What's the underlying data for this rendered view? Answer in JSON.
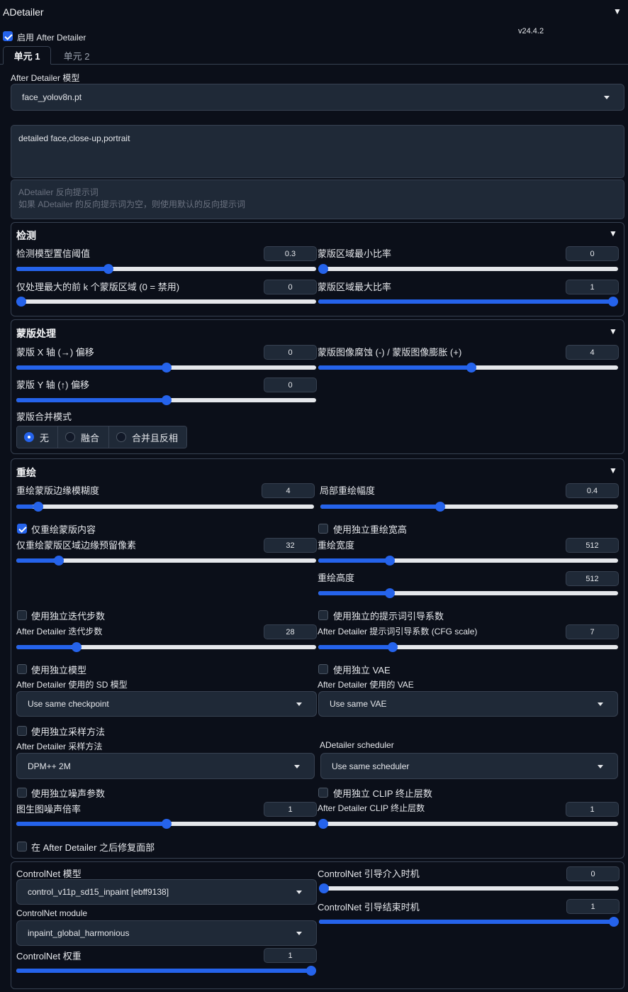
{
  "panel": {
    "title": "ADetailer",
    "version": "v24.4.2",
    "enable_label": "启用 After Detailer",
    "enabled": true
  },
  "tabs": [
    {
      "label": "单元 1",
      "active": true
    },
    {
      "label": "单元 2",
      "active": false
    }
  ],
  "model": {
    "label": "After Detailer 模型",
    "value": "face_yolov8n.pt"
  },
  "prompt": {
    "value": "detailed face,close-up,portrait"
  },
  "negative_prompt": {
    "placeholder_line1": "ADetailer 反向提示词",
    "placeholder_line2": "如果 ADetailer 的反向提示词为空，则使用默认的反向提示词"
  },
  "detection": {
    "title": "检测",
    "confidence": {
      "label": "检测模型置信阈值",
      "value": "0.3",
      "fraction": 0.3
    },
    "mask_min": {
      "label": "蒙版区域最小比率",
      "value": "0",
      "fraction": 0.0
    },
    "top_k": {
      "label": "仅处理最大的前 k 个蒙版区域 (0 = 禁用)",
      "value": "0",
      "fraction": 0.0
    },
    "mask_max": {
      "label": "蒙版区域最大比率",
      "value": "1",
      "fraction": 1.0
    }
  },
  "mask_processing": {
    "title": "蒙版处理",
    "x_offset": {
      "label": "蒙版 X 轴 (→) 偏移",
      "value": "0",
      "fraction": 0.5
    },
    "erode_dilate": {
      "label": "蒙版图像腐蚀 (-) / 蒙版图像膨胀 (+)",
      "value": "4",
      "fraction": 0.51
    },
    "y_offset": {
      "label": "蒙版 Y 轴 (↑) 偏移",
      "value": "0",
      "fraction": 0.5
    },
    "merge_mode": {
      "label": "蒙版合并模式",
      "options": [
        "无",
        "融合",
        "合并且反相"
      ],
      "selected": "无"
    }
  },
  "inpaint": {
    "title": "重绘",
    "mask_blur": {
      "label": "重绘蒙版边缘模糊度",
      "value": "4",
      "fraction": 0.06
    },
    "denoise": {
      "label": "局部重绘幅度",
      "value": "0.4",
      "fraction": 0.4
    },
    "only_masked": {
      "label": "仅重绘蒙版内容",
      "checked": true
    },
    "use_sep_wh": {
      "label": "使用独立重绘宽高",
      "checked": false
    },
    "only_masked_padding": {
      "label": "仅重绘蒙版区域边缘预留像素",
      "value": "32",
      "fraction": 0.13
    },
    "width": {
      "label": "重绘宽度",
      "value": "512",
      "fraction": 0.23
    },
    "height": {
      "label": "重绘高度",
      "value": "512",
      "fraction": 0.23
    },
    "use_sep_steps": {
      "label": "使用独立迭代步数",
      "checked": false
    },
    "use_sep_cfg": {
      "label": "使用独立的提示词引导系数",
      "checked": false
    },
    "steps": {
      "label": "After Detailer 迭代步数",
      "value": "28",
      "fraction": 0.19
    },
    "cfg": {
      "label": "After Detailer 提示词引导系数 (CFG scale)",
      "value": "7",
      "fraction": 0.24
    },
    "use_sep_model": {
      "label": "使用独立模型",
      "checked": false
    },
    "use_sep_vae": {
      "label": "使用独立 VAE",
      "checked": false
    },
    "sd_model": {
      "label": "After Detailer 使用的 SD 模型",
      "value": "Use same checkpoint"
    },
    "vae": {
      "label": "After Detailer 使用的 VAE",
      "value": "Use same VAE"
    },
    "use_sep_sampler": {
      "label": "使用独立采样方法",
      "checked": false
    },
    "sampler": {
      "label": "After Detailer 采样方法",
      "value": "DPM++ 2M"
    },
    "scheduler": {
      "label": "ADetailer scheduler",
      "value": "Use same scheduler"
    },
    "use_sep_noise": {
      "label": "使用独立噪声参数",
      "checked": false
    },
    "use_sep_clip": {
      "label": "使用独立 CLIP 终止层数",
      "checked": false
    },
    "noise_mult": {
      "label": "图生图噪声倍率",
      "value": "1",
      "fraction": 0.5
    },
    "clip_skip": {
      "label": "After Detailer CLIP 终止层数",
      "value": "1",
      "fraction": 0.0
    },
    "restore_face": {
      "label": "在 After Detailer 之后修复面部",
      "checked": false
    }
  },
  "controlnet": {
    "model": {
      "label": "ControlNet 模型",
      "value": "control_v11p_sd15_inpaint [ebff9138]"
    },
    "module": {
      "label": "ControlNet module",
      "value": "inpaint_global_harmonious"
    },
    "weight": {
      "label": "ControlNet 权重",
      "value": "1",
      "fraction": 1.0
    },
    "guidance_start": {
      "label": "ControlNet 引导介入时机",
      "value": "0",
      "fraction": 0.0
    },
    "guidance_end": {
      "label": "ControlNet 引导结束时机",
      "value": "1",
      "fraction": 1.0
    }
  },
  "colors": {
    "background": "#0b0f19",
    "accent": "#2563eb",
    "border": "#374151",
    "input_bg": "#1f2937"
  },
  "icons": {
    "collapse": "triangle-down-icon",
    "dropdown": "caret-down-icon",
    "check": "checkmark-icon"
  }
}
